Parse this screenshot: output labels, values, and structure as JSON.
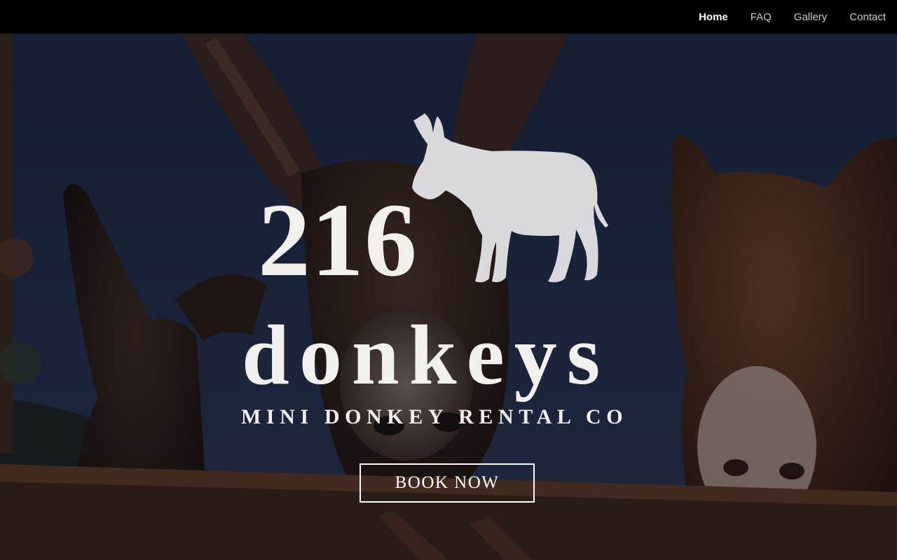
{
  "nav": {
    "items": [
      {
        "label": "Home",
        "active": true
      },
      {
        "label": "FAQ",
        "active": false
      },
      {
        "label": "Gallery",
        "active": false
      },
      {
        "label": "Contact",
        "active": false
      }
    ]
  },
  "hero": {
    "logo_number": "216",
    "logo_word": "donkeys",
    "tagline": "MINI DONKEY RENTAL CO",
    "cta_label": "BOOK NOW",
    "logo_icon": "donkey-silhouette-icon",
    "background_image": "three-donkeys-photo"
  },
  "colors": {
    "nav_bg": "#000000",
    "text_light": "#f2f0ec",
    "sky": "#1f2b44"
  }
}
